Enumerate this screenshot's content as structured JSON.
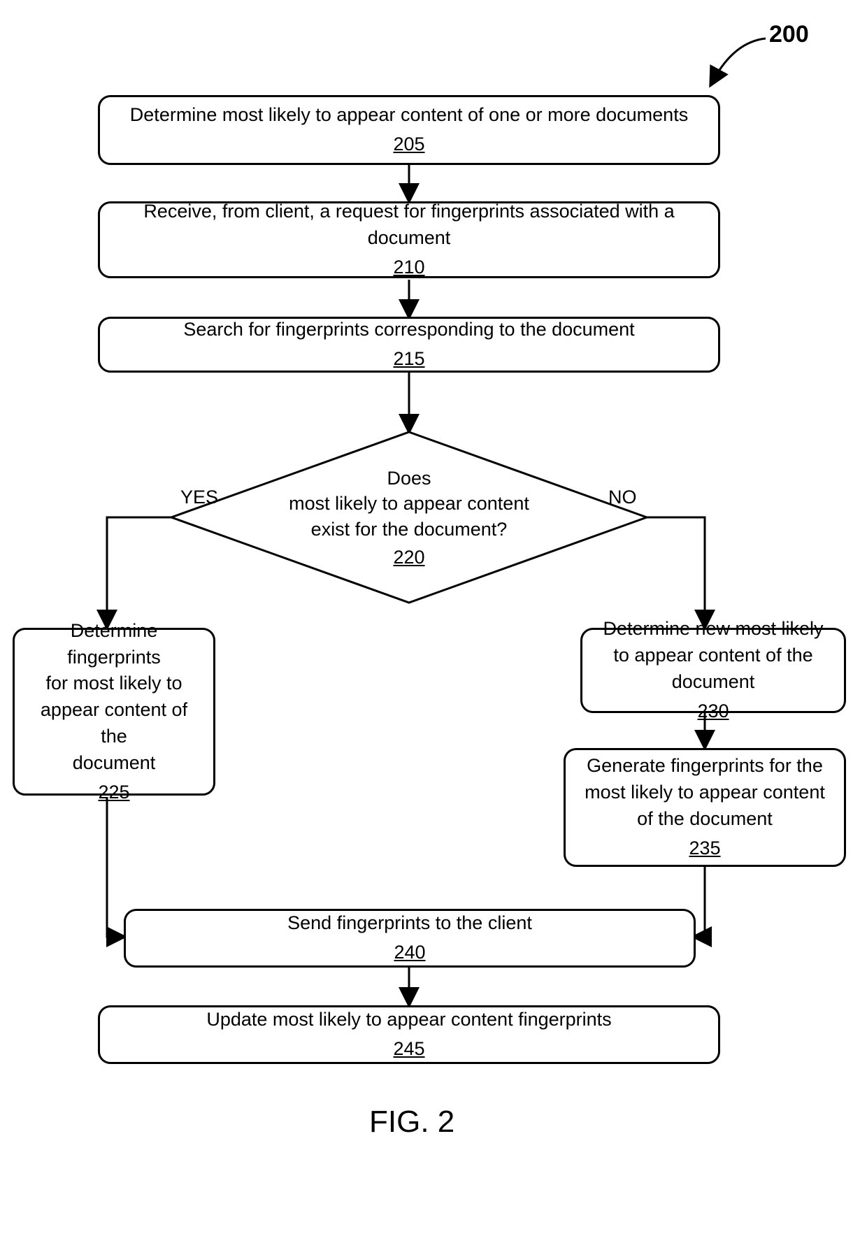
{
  "figure_ref": "200",
  "figure_label": "FIG. 2",
  "decision_yes": "YES",
  "decision_no": "NO",
  "boxes": {
    "b205": {
      "text": "Determine most likely to appear content of one or more documents",
      "ref": "205"
    },
    "b210": {
      "text": "Receive, from client, a request for fingerprints associated with a document",
      "ref": "210"
    },
    "b215": {
      "text": "Search for fingerprints corresponding to the document",
      "ref": "215"
    },
    "d220": {
      "line1": "Does",
      "line2": "most likely to appear content",
      "line3": "exist for the document?",
      "ref": "220"
    },
    "b225": {
      "line1": "Determine fingerprints",
      "line2": "for most likely to",
      "line3": "appear content of the",
      "line4": "document",
      "ref": "225"
    },
    "b230": {
      "text": "Determine new most likely to appear content of the document",
      "ref": "230"
    },
    "b235": {
      "text": "Generate fingerprints for the most likely to appear content of the document",
      "ref": "235"
    },
    "b240": {
      "text": "Send fingerprints to the client",
      "ref": "240"
    },
    "b245": {
      "text": "Update most likely to appear content fingerprints",
      "ref": "245"
    }
  }
}
